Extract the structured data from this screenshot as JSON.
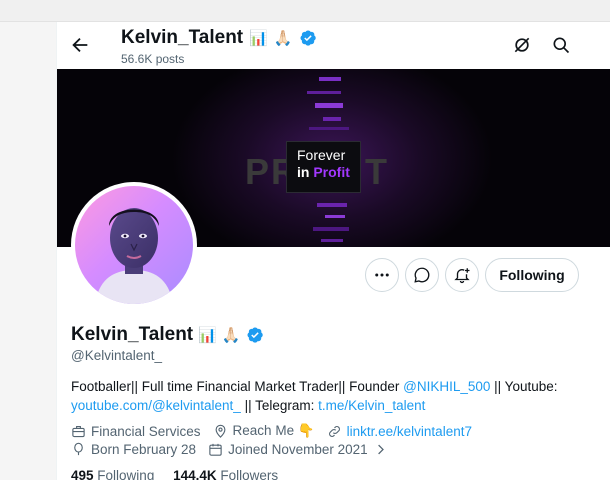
{
  "header": {
    "name": "Kelvin_Talent",
    "emojis": [
      "📊",
      "🙏🏻"
    ],
    "posts": "56.6K posts"
  },
  "banner": {
    "background_word": "PROFIT",
    "line1": "Forever",
    "line2_prefix": "in ",
    "line2_highlight": "Profit"
  },
  "actions": {
    "follow_label": "Following"
  },
  "profile": {
    "name": "Kelvin_Talent",
    "emojis": [
      "📊",
      "🙏🏻"
    ],
    "handle": "@Kelvintalent_"
  },
  "bio": {
    "part1": "Footballer|| Full time Financial Market Trader|| Founder ",
    "mention": "@NIKHIL_500",
    "part2": " || Youtube: ",
    "youtube_link": "youtube.com/@kelvintalent_",
    "part3": " || Telegram: ",
    "telegram_link": "t.me/Kelvin_talent"
  },
  "meta": {
    "category": "Financial Services",
    "location": "Reach Me 👇",
    "website": "linktr.ee/kelvintalent7",
    "birthday": "Born February 28",
    "joined": "Joined November 2021"
  },
  "stats": {
    "following_count": "495",
    "following_label": "Following",
    "followers_count": "144.4K",
    "followers_label": "Followers"
  },
  "colors": {
    "accent": "#1d9bf0",
    "verified": "#1d9bf0",
    "banner_purple": "#a238ff"
  }
}
